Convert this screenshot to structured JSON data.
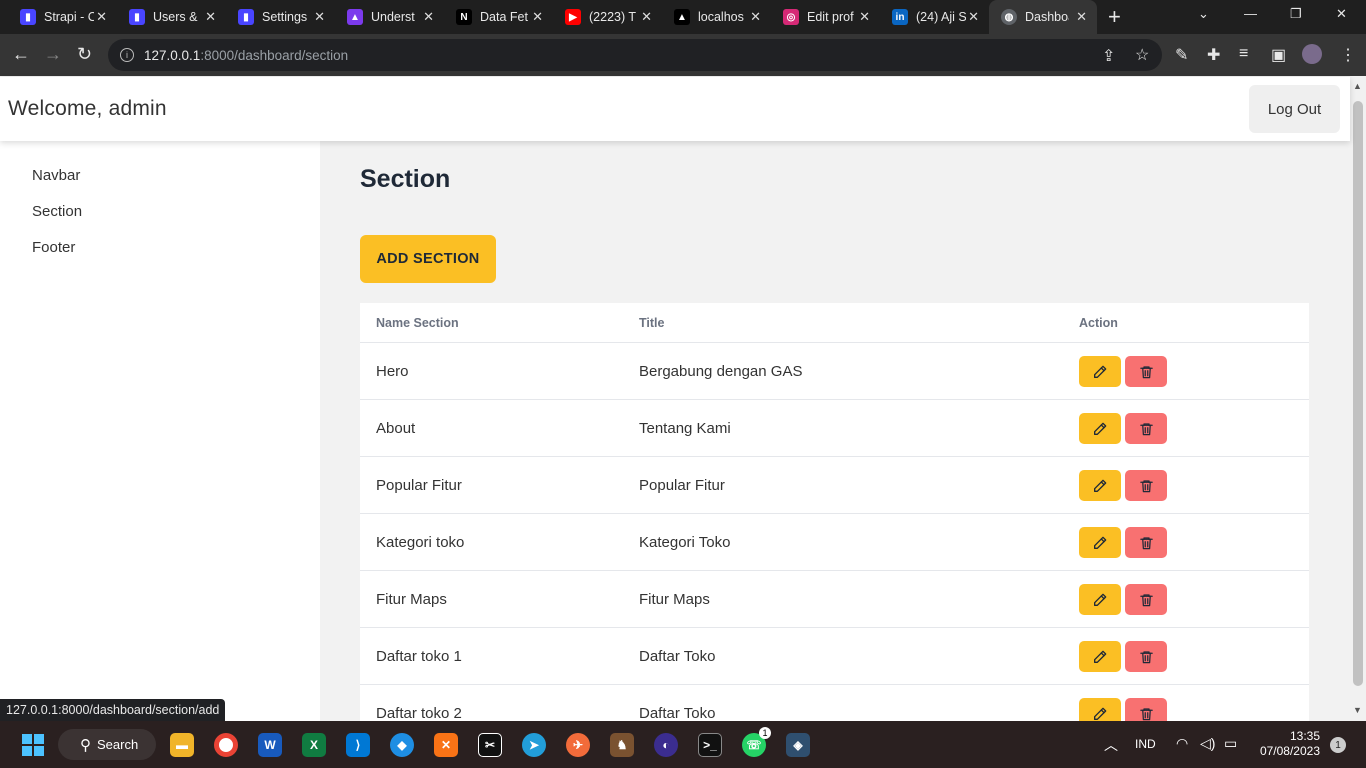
{
  "browser": {
    "tabs": [
      {
        "label": "Strapi - C",
        "icon": "strapi-icon",
        "color": "#4945ff"
      },
      {
        "label": "Users &",
        "icon": "strapi-icon",
        "color": "#4945ff"
      },
      {
        "label": "Settings",
        "icon": "strapi-icon",
        "color": "#4945ff"
      },
      {
        "label": "Underst",
        "icon": "nextauth-icon",
        "color": "#7c3aed"
      },
      {
        "label": "Data Fet",
        "icon": "next-icon",
        "color": "#000000"
      },
      {
        "label": "(2223) T",
        "icon": "youtube-icon",
        "color": "#ff0000"
      },
      {
        "label": "localhos",
        "icon": "vercel-icon",
        "color": "#000000"
      },
      {
        "label": "Edit prof",
        "icon": "instagram-icon",
        "color": "#d62976"
      },
      {
        "label": "(24) Aji S",
        "icon": "linkedin-icon",
        "color": "#0a66c2"
      },
      {
        "label": "Dashboa",
        "icon": "globe-icon",
        "color": "#5f6368"
      }
    ],
    "url_host": "127.0.0.1",
    "url_rest": ":8000/dashboard/section",
    "status_url": "127.0.0.1:8000/dashboard/section/add"
  },
  "header": {
    "welcome": "Welcome, admin",
    "logout_label": "Log Out"
  },
  "sidebar": {
    "items": [
      {
        "label": "Navbar"
      },
      {
        "label": "Section"
      },
      {
        "label": "Footer"
      }
    ]
  },
  "main": {
    "title": "Section",
    "add_label": "ADD SECTION",
    "columns": [
      "Name Section",
      "Title",
      "Action"
    ],
    "rows": [
      {
        "name": "Hero",
        "title": "Bergabung dengan GAS"
      },
      {
        "name": "About",
        "title": "Tentang Kami"
      },
      {
        "name": "Popular Fitur",
        "title": "Popular Fitur"
      },
      {
        "name": "Kategori toko",
        "title": "Kategori Toko"
      },
      {
        "name": "Fitur Maps",
        "title": "Fitur Maps"
      },
      {
        "name": "Daftar toko 1",
        "title": "Daftar Toko"
      },
      {
        "name": "Daftar toko 2",
        "title": "Daftar Toko"
      }
    ],
    "edit_color": "#fbbf24",
    "delete_color": "#f87171"
  },
  "taskbar": {
    "search_label": "Search",
    "language": "IND",
    "time": "13:35",
    "date": "07/08/2023",
    "notification_count": "1",
    "whatsapp_badge": "1"
  }
}
